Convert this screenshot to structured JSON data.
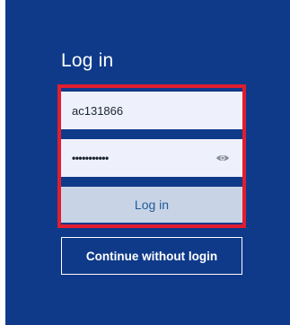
{
  "login": {
    "title": "Log in",
    "username_value": "ac131866",
    "password_value": "•••••••••••",
    "login_button": "Log in",
    "continue_button": "Continue without login"
  },
  "icons": {
    "password_toggle": "eye-icon"
  },
  "colors": {
    "panel_background": "#0f3a8a",
    "highlight_border": "#e01e2f",
    "field_background": "#eef1fb",
    "login_button_background": "#c8d4e6",
    "login_button_text": "#1f5a9a"
  }
}
